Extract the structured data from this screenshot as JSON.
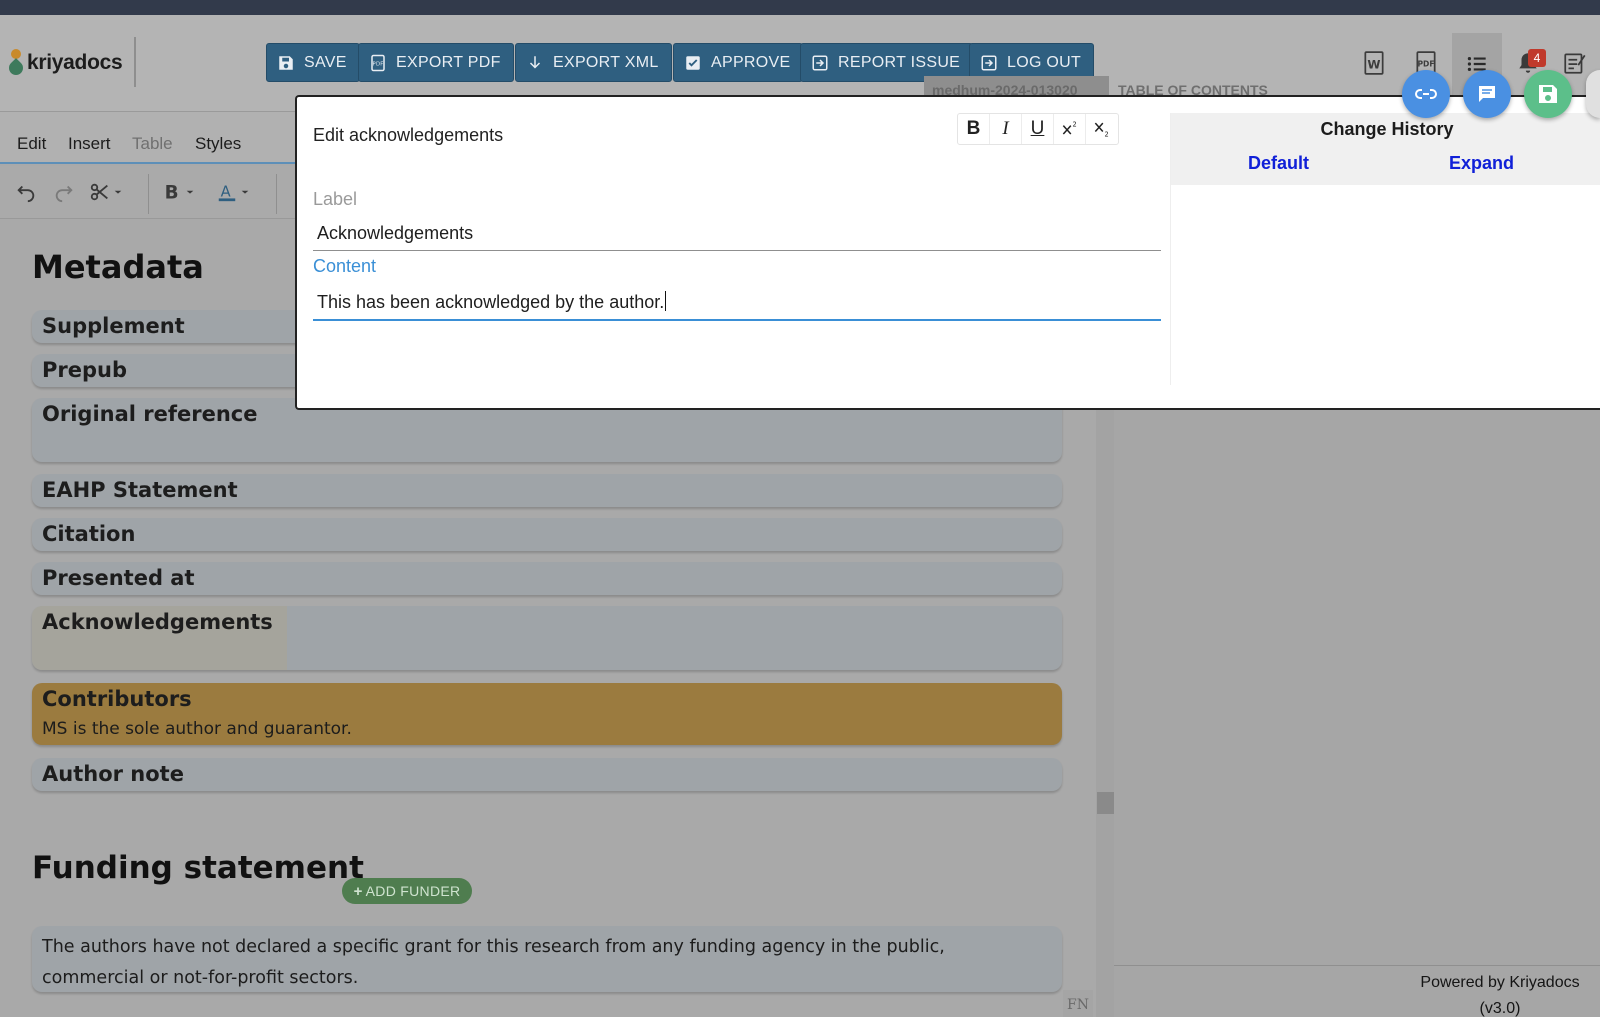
{
  "app": {
    "name": "kriyadocs"
  },
  "toolbar": {
    "save": "SAVE",
    "export_pdf": "EXPORT PDF",
    "export_xml": "EXPORT XML",
    "approve": "APPROVE",
    "report_issue": "REPORT ISSUE",
    "log_out": "LOG OUT"
  },
  "notifications": {
    "count": "4"
  },
  "doc": {
    "id": "medhum-2024-013020"
  },
  "toc": {
    "title": "TABLE OF CONTENTS"
  },
  "menu": {
    "edit": "Edit",
    "insert": "Insert",
    "table": "Table",
    "styles": "Styles"
  },
  "icons": {
    "undo": "undo-icon",
    "redo": "redo-icon",
    "cut": "scissors-icon",
    "bold": "bold-icon",
    "font_color": "font-color-icon",
    "word": "word-doc-icon",
    "pdf": "pdf-icon",
    "list": "list-icon",
    "bell": "bell-icon",
    "notes": "notes-icon"
  },
  "colors": {
    "button_bg": "#2f5f80",
    "accent_blue": "#3a8fd6",
    "contributors_highlight": "#9b7b3f",
    "link_blue": "#1020d8"
  },
  "metadata": {
    "heading": "Metadata",
    "sections": {
      "supplement": "Supplement",
      "prepub": "Prepub",
      "original_reference": "Original reference",
      "eahp": "EAHP Statement",
      "citation": "Citation",
      "presented_at": "Presented at",
      "acknowledgements": "Acknowledgements",
      "contributors": "Contributors",
      "contributors_text": "MS is the sole author and guarantor.",
      "author_note": "Author note"
    }
  },
  "funding": {
    "heading": "Funding statement",
    "add_funder": "ADD FUNDER",
    "text": "The authors have not declared a specific grant for this research from any funding agency in the public, commercial or not-for-profit sectors."
  },
  "footer": {
    "fn": "FN",
    "powered_by": "Powered by Kriyadocs",
    "version": "(v3.0)"
  },
  "modal": {
    "title": "Edit acknowledgements",
    "label_caption": "Label",
    "label_value": "Acknowledgements",
    "content_caption": "Content",
    "content_value": "This has been acknowledged by the author.",
    "format": {
      "bold": "B",
      "italic": "I",
      "underline": "U"
    }
  },
  "history": {
    "title": "Change History",
    "default": "Default",
    "expand": "Expand"
  }
}
